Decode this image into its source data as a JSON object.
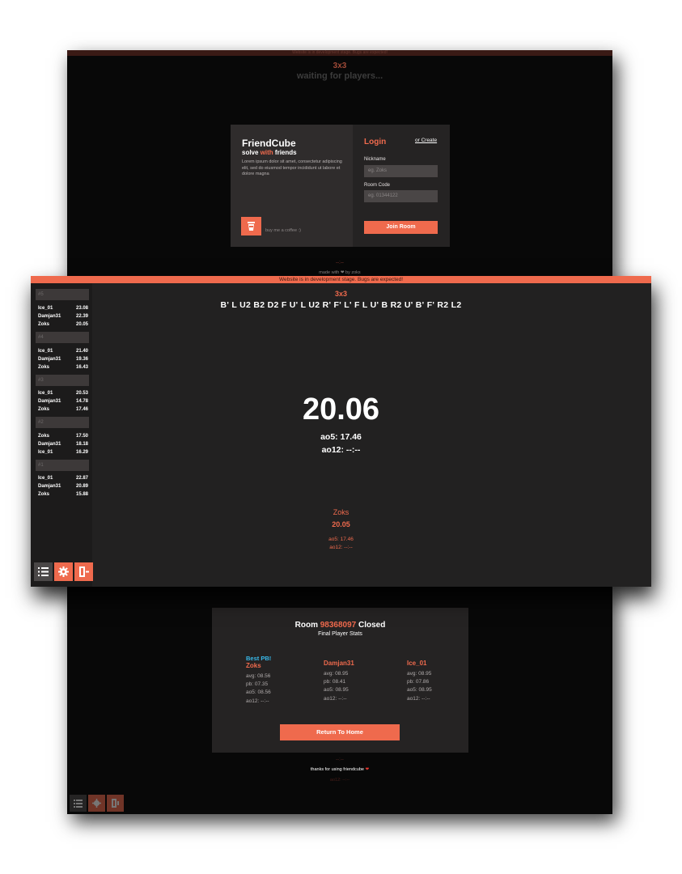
{
  "top": {
    "banner": "Website is in development stage. Bugs are expected!",
    "event": "3x3",
    "status": "waiting for players...",
    "brand": "FriendCube",
    "tagline_pre": "solve ",
    "tagline_hl": "with",
    "tagline_post": " friends",
    "lorem": "Lorem ipsum dolor sit amet, consectetur adipiscing elit, sed do eiusmod tempor incididunt ut labore et dolore magna",
    "coffee_text": "buy me a coffee :)",
    "login_title": "Login",
    "or_create": "or Create",
    "nickname_label": "Nickname",
    "nickname_placeholder": "eg. Zoks",
    "roomcode_label": "Room Code",
    "roomcode_placeholder": "eg. 01344122",
    "join_button": "Join Room",
    "footer_dash": "--:--",
    "footer_made": "made with ❤ by zoks"
  },
  "main": {
    "banner": "Website is in development stage. Bugs are expected!",
    "event": "3x3",
    "scramble": "B' L U2 B2 D2 F U' L U2 R' F' L' F L U' B R2 U' B' F' R2 L2",
    "timer": "20.06",
    "ao5": "ao5: 17.46",
    "ao12": "ao12: --:--",
    "player": {
      "name": "Zoks",
      "time": "20.05",
      "ao5": "ao5: 17.46",
      "ao12": "ao12: --:--"
    },
    "rounds": [
      {
        "label": "#5",
        "results": [
          {
            "name": "Ice_01",
            "time": "23.08"
          },
          {
            "name": "Damjan31",
            "time": "22.39"
          },
          {
            "name": "Zoks",
            "time": "20.05"
          }
        ]
      },
      {
        "label": "#4",
        "results": [
          {
            "name": "Ice_01",
            "time": "21.40"
          },
          {
            "name": "Damjan31",
            "time": "19.36"
          },
          {
            "name": "Zoks",
            "time": "16.43"
          }
        ]
      },
      {
        "label": "#3",
        "results": [
          {
            "name": "Ice_01",
            "time": "20.53"
          },
          {
            "name": "Damjan31",
            "time": "14.78"
          },
          {
            "name": "Zoks",
            "time": "17.46"
          }
        ]
      },
      {
        "label": "#2",
        "results": [
          {
            "name": "Zoks",
            "time": "17.50"
          },
          {
            "name": "Damjan31",
            "time": "18.18"
          },
          {
            "name": "Ice_01",
            "time": "16.29"
          }
        ]
      },
      {
        "label": "#1",
        "results": [
          {
            "name": "Ice_01",
            "time": "22.87"
          },
          {
            "name": "Damjan31",
            "time": "20.89"
          },
          {
            "name": "Zoks",
            "time": "15.88"
          }
        ]
      }
    ],
    "controls": [
      {
        "icon": "list-icon",
        "color": "#4a4747"
      },
      {
        "icon": "gear-icon",
        "color": "#ef6a4d"
      },
      {
        "icon": "exit-icon",
        "color": "#ef6a4d"
      }
    ]
  },
  "closed": {
    "title_pre": "Room ",
    "room_code": "98368097",
    "title_post": " Closed",
    "subtitle": "Final Player Stats",
    "players": [
      {
        "badge": "Best PB!",
        "name": "Zoks",
        "avg": "avg: 08.56",
        "pb": "pb: 07.35",
        "ao5": "ao5: 08.56",
        "ao12": "ao12: --:--"
      },
      {
        "badge": "",
        "name": "Damjan31",
        "avg": "avg: 08.95",
        "pb": "pb: 08.41",
        "ao5": "ao5: 08.95",
        "ao12": "ao12: --:--"
      },
      {
        "badge": "",
        "name": "Ice_01",
        "avg": "avg: 08.95",
        "pb": "pb: 07.86",
        "ao5": "ao5: 08.95",
        "ao12": "ao12: --:--"
      }
    ],
    "return_button": "Return To Home",
    "footer_dash": "--:--",
    "thanks": "thanks for using friendcube",
    "ghost_text": "ao12: --:--"
  },
  "colors": {
    "accent": "#ef6a4d",
    "panel": "#252323",
    "background": "#080808",
    "best_pb": "#38b8e8"
  }
}
